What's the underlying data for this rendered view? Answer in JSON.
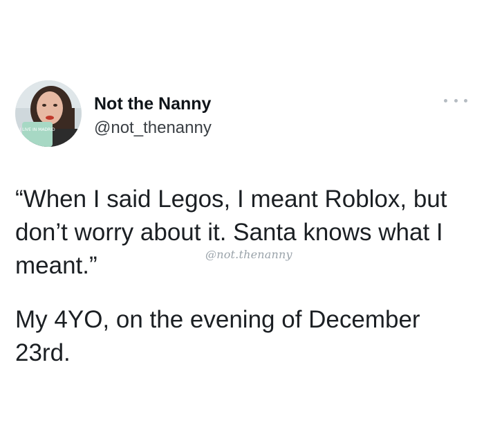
{
  "tweet": {
    "author": {
      "display_name": "Not the Nanny",
      "handle": "@not_thenanny",
      "avatar_mug_text": "I LIVE IN MADRID"
    },
    "more_icon": "more-horizontal-icon",
    "text_line_1": "“When I said Legos, I meant Roblox, but don’t worry about it. Santa knows what I meant.”",
    "text_line_2": "My 4YO, on the evening of December 23rd.",
    "watermark": "@not.thenanny"
  },
  "colors": {
    "text": "#0f1419",
    "secondary_text": "#3a3f44",
    "more_icon": "#b5bcc2",
    "watermark": "#9aa3aa"
  }
}
